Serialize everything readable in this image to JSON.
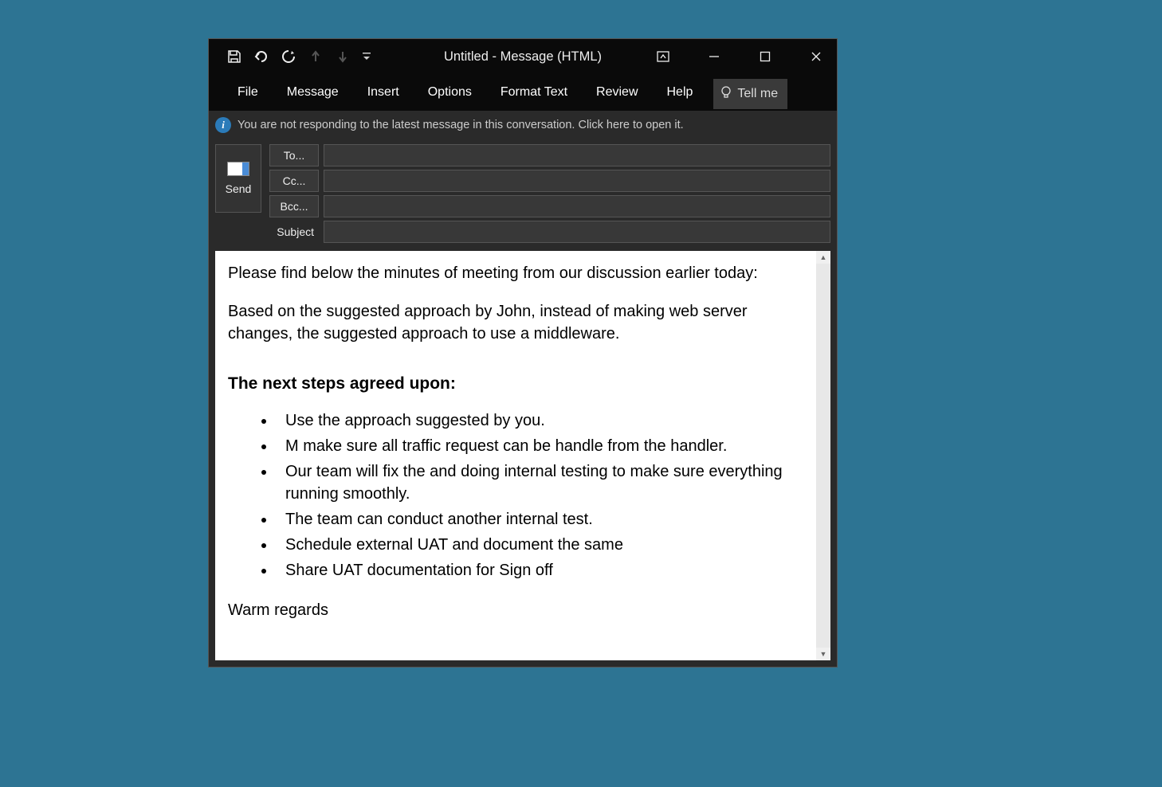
{
  "titlebar": {
    "title": "Untitled  -  Message (HTML)"
  },
  "ribbon": {
    "tabs": [
      "File",
      "Message",
      "Insert",
      "Options",
      "Format Text",
      "Review",
      "Help"
    ],
    "tellme": "Tell me"
  },
  "infobar": {
    "text": "You are not responding to the latest message in this conversation. Click here to open it."
  },
  "send": {
    "label": "Send"
  },
  "fields": {
    "to_label": "To...",
    "cc_label": "Cc...",
    "bcc_label": "Bcc...",
    "subject_label": "Subject",
    "to_value": "",
    "cc_value": "",
    "bcc_value": "",
    "subject_value": ""
  },
  "body": {
    "p1": "Please find below the minutes of meeting from our discussion earlier today:",
    "p2_a": "Based on the suggested approach by John, instead of making web server changes, the ",
    "p2_b": "suggested approach to use a middleware.",
    "heading": "The next steps agreed upon:",
    "bullets": [
      "Use the approach suggested by you.",
      "M make sure all traffic request can be handle from the handler.",
      "Our team will fix the and doing internal testing to make sure everything running smoothly.",
      "The team can conduct another internal test.",
      "Schedule external UAT and document the same",
      "Share UAT documentation for Sign off"
    ],
    "closing": "Warm regards"
  }
}
